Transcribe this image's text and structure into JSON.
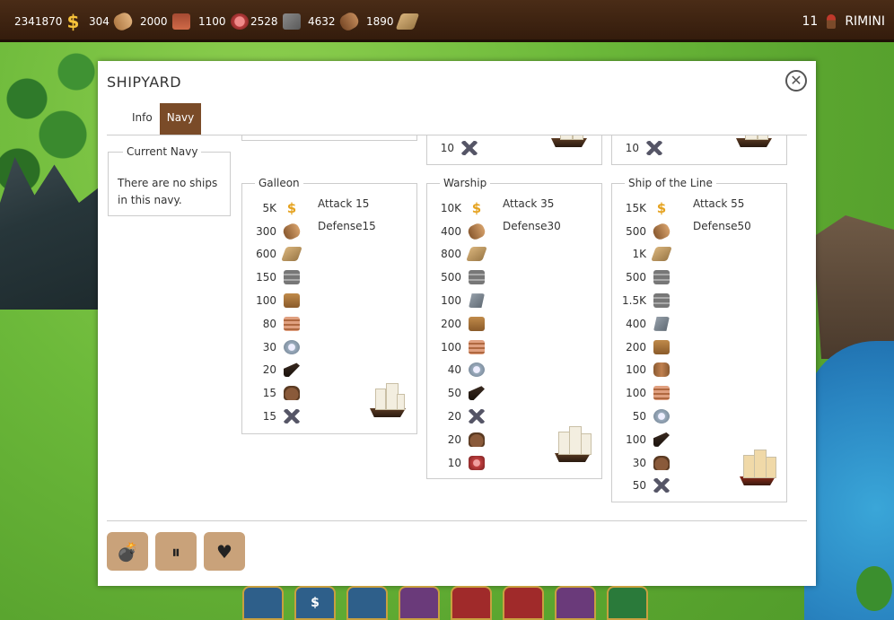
{
  "topbar": {
    "resources": [
      {
        "value": "2341870",
        "icon": "gold-coin-icon"
      },
      {
        "value": "304",
        "icon": "wood-icon"
      },
      {
        "value": "2000",
        "icon": "brick-icon"
      },
      {
        "value": "1100",
        "icon": "meat-icon"
      },
      {
        "value": "2528",
        "icon": "stone-icon"
      },
      {
        "value": "4632",
        "icon": "log-icon"
      },
      {
        "value": "1890",
        "icon": "plank-icon"
      }
    ],
    "level": "11",
    "city": "RIMINI"
  },
  "dialog": {
    "title": "SHIPYARD",
    "tabs": [
      {
        "label": "Info"
      },
      {
        "label": "Navy"
      }
    ],
    "active_tab": "Navy",
    "current_navy": {
      "legend": "Current Navy",
      "text": "There are no ships in this navy."
    },
    "top_partial": {
      "col2_qty": "10",
      "col3_qty": "10"
    },
    "ships": [
      {
        "name": "Galleon",
        "attack_label": "Attack",
        "attack": "15",
        "defense_label": "Defense",
        "defense": "15",
        "costs": [
          {
            "qty": "5K",
            "icon": "gold-coin-icon"
          },
          {
            "qty": "300",
            "icon": "wood-icon"
          },
          {
            "qty": "600",
            "icon": "plank-icon"
          },
          {
            "qty": "150",
            "icon": "iron-icon"
          },
          {
            "qty": "100",
            "icon": "crate-icon"
          },
          {
            "qty": "80",
            "icon": "cloth-icon"
          },
          {
            "qty": "30",
            "icon": "rope-icon"
          },
          {
            "qty": "20",
            "icon": "cannon-icon"
          },
          {
            "qty": "15",
            "icon": "sack-icon"
          },
          {
            "qty": "15",
            "icon": "sword-icon"
          }
        ]
      },
      {
        "name": "Warship",
        "attack_label": "Attack",
        "attack": "35",
        "defense_label": "Defense",
        "defense": "30",
        "costs": [
          {
            "qty": "10K",
            "icon": "gold-coin-icon"
          },
          {
            "qty": "400",
            "icon": "wood-icon"
          },
          {
            "qty": "800",
            "icon": "plank-icon"
          },
          {
            "qty": "500",
            "icon": "iron-icon"
          },
          {
            "qty": "100",
            "icon": "ingot-icon"
          },
          {
            "qty": "200",
            "icon": "crate-icon"
          },
          {
            "qty": "100",
            "icon": "cloth-icon"
          },
          {
            "qty": "40",
            "icon": "rope-icon"
          },
          {
            "qty": "50",
            "icon": "cannon-icon"
          },
          {
            "qty": "20",
            "icon": "sword-icon"
          },
          {
            "qty": "20",
            "icon": "sack-icon"
          },
          {
            "qty": "10",
            "icon": "meat-icon"
          }
        ]
      },
      {
        "name": "Ship of the Line",
        "attack_label": "Attack",
        "attack": "55",
        "defense_label": "Defense",
        "defense": "50",
        "costs": [
          {
            "qty": "15K",
            "icon": "gold-coin-icon"
          },
          {
            "qty": "500",
            "icon": "wood-icon"
          },
          {
            "qty": "1K",
            "icon": "plank-icon"
          },
          {
            "qty": "500",
            "icon": "iron-icon"
          },
          {
            "qty": "1.5K",
            "icon": "iron-icon"
          },
          {
            "qty": "400",
            "icon": "ingot-icon"
          },
          {
            "qty": "200",
            "icon": "crate-icon"
          },
          {
            "qty": "100",
            "icon": "barrel-icon"
          },
          {
            "qty": "100",
            "icon": "cloth-icon"
          },
          {
            "qty": "50",
            "icon": "rope-icon"
          },
          {
            "qty": "100",
            "icon": "cannon-icon"
          },
          {
            "qty": "30",
            "icon": "sack-icon"
          },
          {
            "qty": "50",
            "icon": "sword-icon"
          }
        ]
      }
    ],
    "bottom_buttons": [
      {
        "icon": "bomb-icon",
        "glyph": "💣"
      },
      {
        "icon": "pause-icon",
        "glyph": "⏸"
      },
      {
        "icon": "heart-icon",
        "glyph": "♥"
      }
    ]
  },
  "bottom_bar": {
    "icons": [
      "house-icon",
      "bank-icon",
      "market-icon",
      "academy-icon",
      "tavern-icon",
      "library-icon",
      "church-icon",
      "restaurant-icon"
    ],
    "bank_glyph": "$"
  }
}
